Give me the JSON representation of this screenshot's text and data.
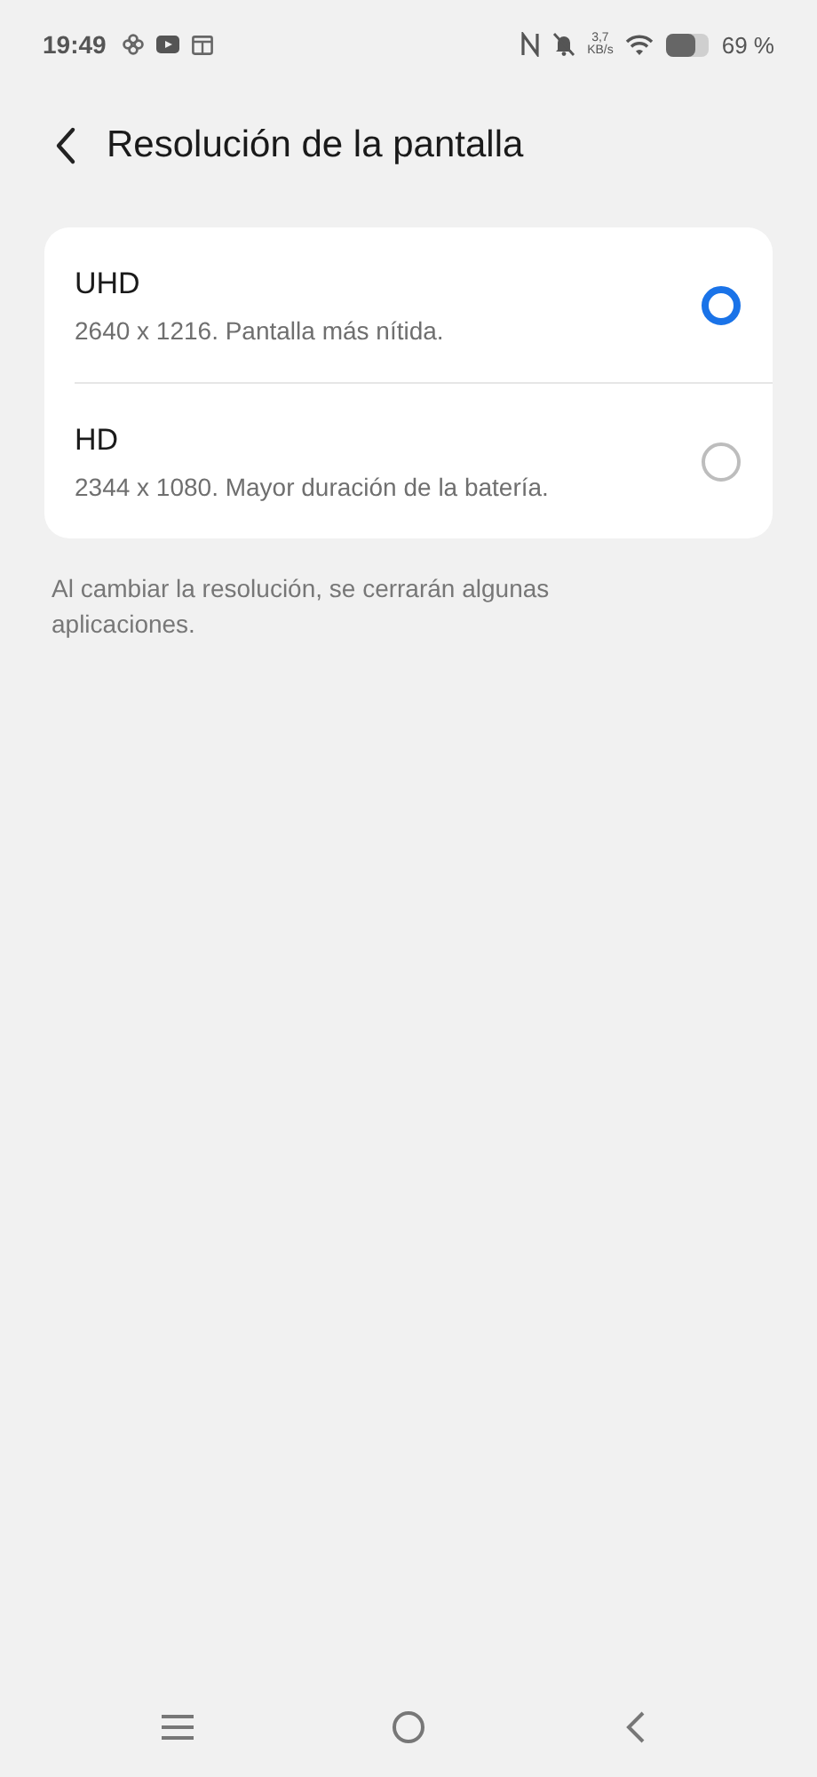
{
  "status_bar": {
    "time": "19:49",
    "speed_value": "3,7",
    "speed_unit": "KB/s",
    "battery": "69 %"
  },
  "header": {
    "title": "Resolución de la pantalla"
  },
  "options": [
    {
      "title": "UHD",
      "description": "2640 x 1216. Pantalla más nítida.",
      "selected": true
    },
    {
      "title": "HD",
      "description": "2344 x 1080. Mayor duración de la batería.",
      "selected": false
    }
  ],
  "note": "Al cambiar la resolución, se cerrarán algunas aplicaciones."
}
